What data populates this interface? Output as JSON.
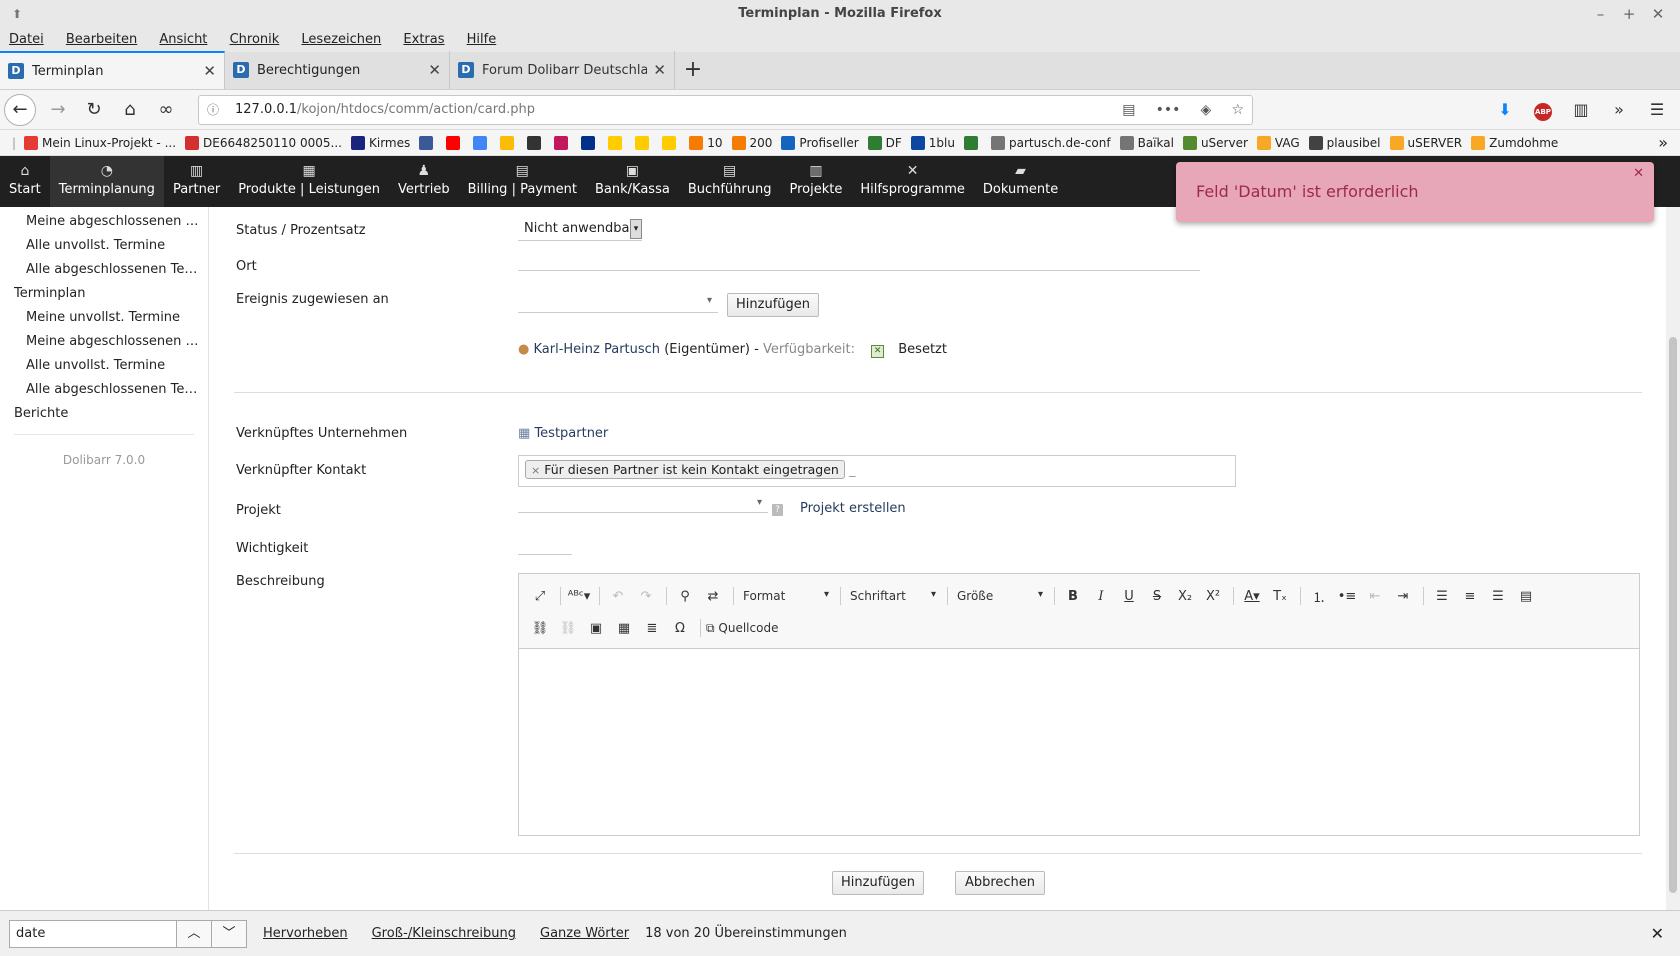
{
  "window": {
    "title": "Terminplan - Mozilla Firefox",
    "controls": [
      "–",
      "+",
      "✕"
    ]
  },
  "menubar": [
    "Datei",
    "Bearbeiten",
    "Ansicht",
    "Chronik",
    "Lesezeichen",
    "Extras",
    "Hilfe"
  ],
  "tabs": [
    {
      "label": "Terminplan",
      "active": true
    },
    {
      "label": "Berechtigungen",
      "active": false
    },
    {
      "label": "Forum Dolibarr Deutschland",
      "active": false
    }
  ],
  "url": {
    "host": "127.0.0.1",
    "path": "/kojon/htdocs/comm/action/card.php"
  },
  "bookmarks": [
    {
      "label": "Mein Linux-Projekt - ...",
      "color": "#e53935"
    },
    {
      "label": "DE6648250110 0005...",
      "color": "#d32f2f"
    },
    {
      "label": "Kirmes",
      "color": "#1a237e"
    },
    {
      "label": "",
      "color": "#3b5998"
    },
    {
      "label": "",
      "color": "#ff0000"
    },
    {
      "label": "",
      "color": "#4285f4"
    },
    {
      "label": "",
      "color": "#fbbc05"
    },
    {
      "label": "",
      "color": "#333333"
    },
    {
      "label": "",
      "color": "#c2185b"
    },
    {
      "label": "",
      "color": "#003087"
    },
    {
      "label": "",
      "color": "#ffcc00"
    },
    {
      "label": "",
      "color": "#ffcc00"
    },
    {
      "label": "",
      "color": "#ffcc00"
    },
    {
      "label": "10",
      "color": "#f57c00"
    },
    {
      "label": "200",
      "color": "#f57c00"
    },
    {
      "label": "Profiseller",
      "color": "#1565c0"
    },
    {
      "label": "DF",
      "color": "#2e7d32"
    },
    {
      "label": "1blu",
      "color": "#0d47a1"
    },
    {
      "label": "",
      "color": "#2e7d32"
    },
    {
      "label": "partusch.de-conf",
      "color": "#757575"
    },
    {
      "label": "Baïkal",
      "color": "#757575"
    },
    {
      "label": "uServer",
      "color": "#558b2f"
    },
    {
      "label": "VAG",
      "color": "#f9a825"
    },
    {
      "label": "plausibel",
      "color": "#424242"
    },
    {
      "label": "uSERVER",
      "color": "#f9a825"
    },
    {
      "label": "Zumdohme",
      "color": "#f9a825"
    }
  ],
  "appmenu": [
    {
      "label": "Start",
      "icon": "⌂"
    },
    {
      "label": "Terminplanung",
      "icon": "◔"
    },
    {
      "label": "Partner",
      "icon": "▥"
    },
    {
      "label": "Produkte | Leistungen",
      "icon": "▦"
    },
    {
      "label": "Vertrieb",
      "icon": "♟"
    },
    {
      "label": "Billing | Payment",
      "icon": "▤"
    },
    {
      "label": "Bank/Kassa",
      "icon": "▣"
    },
    {
      "label": "Buchführung",
      "icon": "▤"
    },
    {
      "label": "Projekte",
      "icon": "▥"
    },
    {
      "label": "Hilfsprogramme",
      "icon": "✕"
    },
    {
      "label": "Dokumente",
      "icon": "▰"
    }
  ],
  "toast": {
    "message": "Feld 'Datum' ist erforderlich",
    "close": "✕"
  },
  "sidebar": {
    "items": [
      {
        "label": "Meine abgeschlossenen T...",
        "level": 2
      },
      {
        "label": "Alle unvollst. Termine",
        "level": 2
      },
      {
        "label": "Alle abgeschlossenen Ter...",
        "level": 2
      },
      {
        "label": "Terminplan",
        "level": 1
      },
      {
        "label": "Meine unvollst. Termine",
        "level": 2
      },
      {
        "label": "Meine abgeschlossenen T...",
        "level": 2
      },
      {
        "label": "Alle unvollst. Termine",
        "level": 2
      },
      {
        "label": "Alle abgeschlossenen Ter...",
        "level": 2
      },
      {
        "label": "Berichte",
        "level": 1
      }
    ],
    "version": "Dolibarr 7.0.0"
  },
  "form": {
    "status_label": "Status / Prozentsatz",
    "status_value": "Nicht anwendbar",
    "ort_label": "Ort",
    "assigned_label": "Ereignis zugewiesen an",
    "add_button": "Hinzufügen",
    "assignee_name": "Karl-Heinz Partusch",
    "assignee_role": "(Eigentümer) -",
    "availability_label": "Verfügbarkeit:",
    "availability_value": "Besetzt",
    "company_label": "Verknüpftes Unternehmen",
    "company_value": "Testpartner",
    "contact_label": "Verknüpfter Kontakt",
    "contact_tag": "Für diesen Partner ist kein Kontakt eingetragen",
    "project_label": "Projekt",
    "project_create": "Projekt erstellen",
    "priority_label": "Wichtigkeit",
    "description_label": "Beschreibung",
    "submit_button": "Hinzufügen",
    "cancel_button": "Abbrechen"
  },
  "editor": {
    "format": "Format",
    "font": "Schriftart",
    "size": "Größe",
    "source": "Quellcode"
  },
  "findbar": {
    "query": "date",
    "highlight": "Hervorheben",
    "case": "Groß-/Kleinschreibung",
    "whole": "Ganze Wörter",
    "status": "18 von 20 Übereinstimmungen"
  }
}
